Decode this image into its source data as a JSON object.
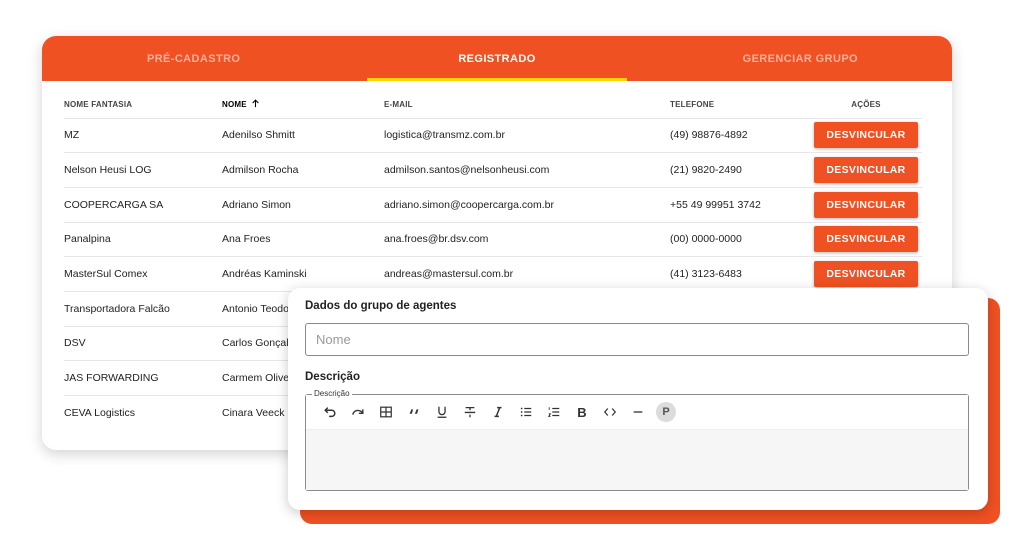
{
  "tabs": [
    {
      "label": "PRÉ-CADASTRO",
      "active": false
    },
    {
      "label": "REGISTRADO",
      "active": true
    },
    {
      "label": "GERENCIAR GRUPO",
      "active": false
    }
  ],
  "table": {
    "headers": {
      "nome_fantasia": "NOME FANTASIA",
      "nome": "NOME",
      "email": "E-MAIL",
      "telefone": "TELEFONE",
      "acoes": "AÇÕES"
    },
    "sorted_column": "nome",
    "sort_direction": "ascending",
    "action_label": "DESVINCULAR",
    "rows": [
      {
        "nome_fantasia": "MZ",
        "nome": "Adenilso Shmitt",
        "email": "logistica@transmz.com.br",
        "telefone": "(49) 98876-4892"
      },
      {
        "nome_fantasia": "Nelson Heusi LOG",
        "nome": "Admilson Rocha",
        "email": "admilson.santos@nelsonheusi.com",
        "telefone": "(21) 9820-2490"
      },
      {
        "nome_fantasia": "COOPERCARGA SA",
        "nome": "Adriano Simon",
        "email": "adriano.simon@coopercarga.com.br",
        "telefone": "+55 49 99951 3742"
      },
      {
        "nome_fantasia": "Panalpina",
        "nome": "Ana Froes",
        "email": "ana.froes@br.dsv.com",
        "telefone": "(00) 0000-0000"
      },
      {
        "nome_fantasia": "MasterSul Comex",
        "nome": "Andréas Kaminski",
        "email": "andreas@mastersul.com.br",
        "telefone": "(41) 3123-6483"
      },
      {
        "nome_fantasia": "Transportadora Falcão",
        "nome": "Antonio Teodo",
        "email": "",
        "telefone": ""
      },
      {
        "nome_fantasia": "DSV",
        "nome": "Carlos Gonçalv",
        "email": "",
        "telefone": ""
      },
      {
        "nome_fantasia": "JAS FORWARDING",
        "nome": "Carmem Olivei",
        "email": "",
        "telefone": ""
      },
      {
        "nome_fantasia": "CEVA Logistics",
        "nome": "Cinara Veeck",
        "email": "",
        "telefone": ""
      }
    ]
  },
  "form": {
    "heading": "Dados do grupo de agentes",
    "name_placeholder": "Nome",
    "description_heading": "Descrição",
    "editor_legend": "Descrição",
    "toolbar": [
      {
        "icon": "undo-icon"
      },
      {
        "icon": "redo-icon"
      },
      {
        "icon": "table-icon"
      },
      {
        "icon": "blockquote-icon"
      },
      {
        "icon": "underline-icon"
      },
      {
        "icon": "strikethrough-icon"
      },
      {
        "icon": "italic-icon"
      },
      {
        "icon": "bullet-list-icon"
      },
      {
        "icon": "ordered-list-icon"
      },
      {
        "icon": "bold-icon",
        "text": "B"
      },
      {
        "icon": "code-icon"
      },
      {
        "icon": "horizontal-rule-icon"
      },
      {
        "icon": "paragraph-icon",
        "text": "P"
      }
    ]
  },
  "colors": {
    "brand_orange": "#f05123",
    "tab_indicator": "#ffd400"
  }
}
